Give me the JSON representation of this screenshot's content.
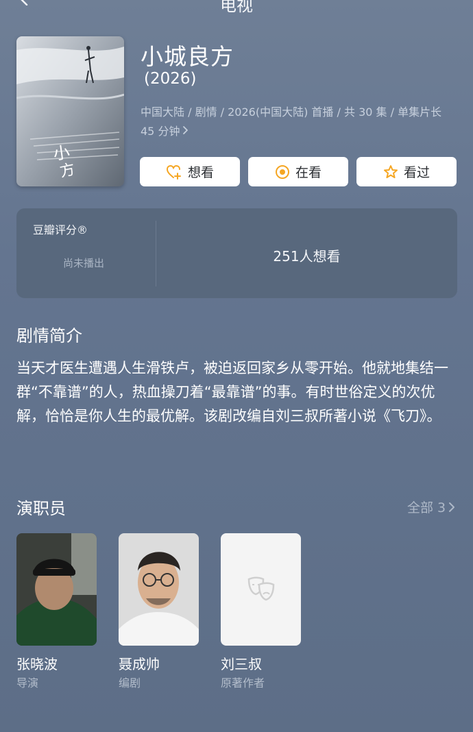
{
  "nav": {
    "title": "电视",
    "back_icon": "chevron-left-icon"
  },
  "show": {
    "title": "小城良方",
    "year": "(2026)",
    "meta": "中国大陆 / 剧情 / 2026(中国大陆) 首播 / 共 30 集 / 单集片长 45 分钟",
    "poster_title": "小城良方",
    "actions": [
      {
        "label": "想看",
        "icon": "heart-plus-icon"
      },
      {
        "label": "在看",
        "icon": "target-circle-icon"
      },
      {
        "label": "看过",
        "icon": "star-icon"
      }
    ]
  },
  "rating": {
    "label": "豆瓣评分®",
    "status": "尚未播出",
    "want_count": "251人想看"
  },
  "synopsis": {
    "title": "剧情简介",
    "text": "当天才医生遭遇人生滑铁卢，被迫返回家乡从零开始。他就地集结一群“不靠谱”的人，热血操刀着“最靠谱”的事。有时世俗定义的次优解，恰恰是你人生的最优解。该剧改编自刘三叔所著小说《飞刀》。"
  },
  "cast": {
    "title": "演职员",
    "all_label": "全部 3",
    "members": [
      {
        "name": "张晓波",
        "role": "导演"
      },
      {
        "name": "聂成帅",
        "role": "编剧"
      },
      {
        "name": "刘三叔",
        "role": "原著作者"
      }
    ]
  },
  "colors": {
    "accent": "#f5a623",
    "background": "#647590",
    "card": "#58687d"
  }
}
